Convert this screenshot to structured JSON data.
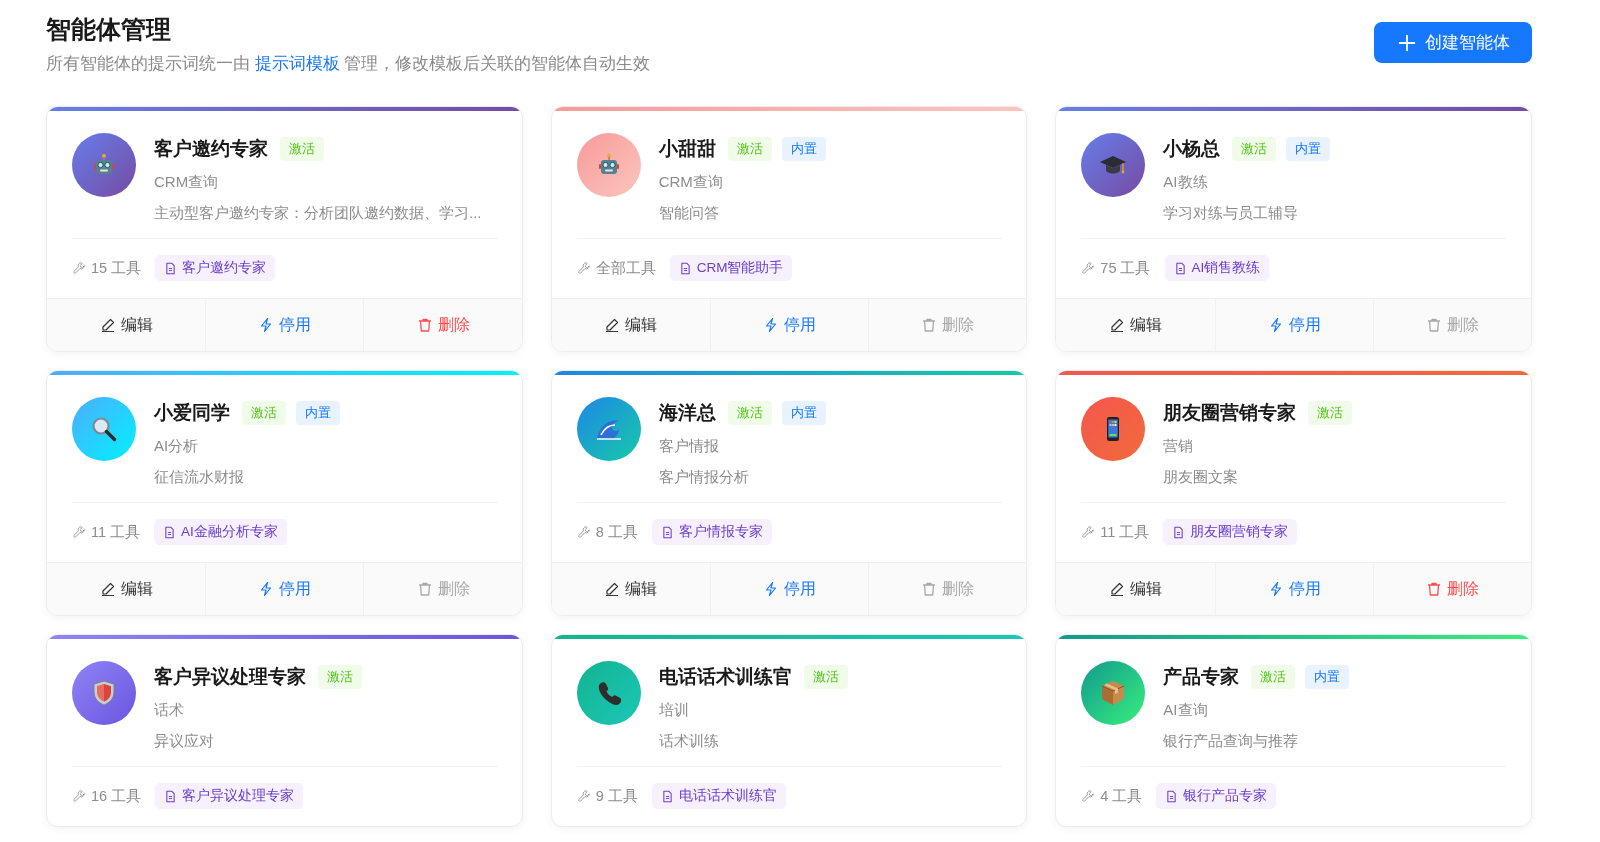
{
  "header": {
    "title": "智能体管理",
    "subtitle_before": "所有智能体的提示词统一由 ",
    "subtitle_link": "提示词模板",
    "subtitle_after": " 管理，修改模板后关联的智能体自动生效",
    "create_button": "创建智能体"
  },
  "agents": [
    {
      "name": "客户邀约专家",
      "badges": [
        {
          "label": "激活",
          "kind": "active"
        }
      ],
      "category": "CRM查询",
      "description": "主动型客户邀约专家：分析团队邀约数据、学习...",
      "tools": "15 工具",
      "template": "客户邀约专家",
      "actions": [
        {
          "label": "编辑",
          "kind": "edit",
          "disabled": false
        },
        {
          "label": "停用",
          "kind": "disable",
          "disabled": false
        },
        {
          "label": "删除",
          "kind": "delete",
          "disabled": false
        }
      ]
    },
    {
      "name": "小甜甜",
      "badges": [
        {
          "label": "激活",
          "kind": "active"
        },
        {
          "label": "内置",
          "kind": "builtin"
        }
      ],
      "category": "CRM查询",
      "description": "智能问答",
      "tools": "全部工具",
      "template": "CRM智能助手",
      "actions": [
        {
          "label": "编辑",
          "kind": "edit",
          "disabled": false
        },
        {
          "label": "停用",
          "kind": "disable",
          "disabled": false
        },
        {
          "label": "删除",
          "kind": "delete",
          "disabled": true
        }
      ]
    },
    {
      "name": "小杨总",
      "badges": [
        {
          "label": "激活",
          "kind": "active"
        },
        {
          "label": "内置",
          "kind": "builtin"
        }
      ],
      "category": "AI教练",
      "description": "学习对练与员工辅导",
      "tools": "75 工具",
      "template": "AI销售教练",
      "actions": [
        {
          "label": "编辑",
          "kind": "edit",
          "disabled": false
        },
        {
          "label": "停用",
          "kind": "disable",
          "disabled": false
        },
        {
          "label": "删除",
          "kind": "delete",
          "disabled": true
        }
      ]
    },
    {
      "name": "小爱同学",
      "badges": [
        {
          "label": "激活",
          "kind": "active"
        },
        {
          "label": "内置",
          "kind": "builtin"
        }
      ],
      "category": "AI分析",
      "description": "征信流水财报",
      "tools": "11 工具",
      "template": "AI金融分析专家",
      "actions": [
        {
          "label": "编辑",
          "kind": "edit",
          "disabled": false
        },
        {
          "label": "停用",
          "kind": "disable",
          "disabled": false
        },
        {
          "label": "删除",
          "kind": "delete",
          "disabled": true
        }
      ]
    },
    {
      "name": "海洋总",
      "badges": [
        {
          "label": "激活",
          "kind": "active"
        },
        {
          "label": "内置",
          "kind": "builtin"
        }
      ],
      "category": "客户情报",
      "description": "客户情报分析",
      "tools": "8 工具",
      "template": "客户情报专家",
      "actions": [
        {
          "label": "编辑",
          "kind": "edit",
          "disabled": false
        },
        {
          "label": "停用",
          "kind": "disable",
          "disabled": false
        },
        {
          "label": "删除",
          "kind": "delete",
          "disabled": true
        }
      ]
    },
    {
      "name": "朋友圈营销专家",
      "badges": [
        {
          "label": "激活",
          "kind": "active"
        }
      ],
      "category": "营销",
      "description": "朋友圈文案",
      "tools": "11 工具",
      "template": "朋友圈营销专家",
      "actions": [
        {
          "label": "编辑",
          "kind": "edit",
          "disabled": false
        },
        {
          "label": "停用",
          "kind": "disable",
          "disabled": false
        },
        {
          "label": "删除",
          "kind": "delete",
          "disabled": false
        }
      ]
    },
    {
      "name": "客户异议处理专家",
      "badges": [
        {
          "label": "激活",
          "kind": "active"
        }
      ],
      "category": "话术",
      "description": "异议应对",
      "tools": "16 工具",
      "template": "客户异议处理专家"
    },
    {
      "name": "电话话术训练官",
      "badges": [
        {
          "label": "激活",
          "kind": "active"
        }
      ],
      "category": "培训",
      "description": "话术训练",
      "tools": "9 工具",
      "template": "电话话术训练官"
    },
    {
      "name": "产品专家",
      "badges": [
        {
          "label": "激活",
          "kind": "active"
        },
        {
          "label": "内置",
          "kind": "builtin"
        }
      ],
      "category": "AI查询",
      "description": "银行产品查询与推荐",
      "tools": "4 工具",
      "template": "银行产品专家"
    }
  ]
}
